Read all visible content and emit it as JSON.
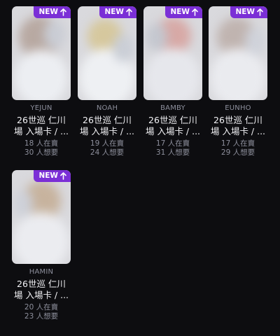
{
  "cards": [
    {
      "badge": "NEW",
      "badge_icon": "arrow-up-icon",
      "member": "YEJUN",
      "title_line1": "26世巡 仁川",
      "title_line2": "場 入場卡 / ...",
      "selling": "18 人在賣",
      "wanting": "30 人想要"
    },
    {
      "badge": "NEW",
      "badge_icon": "arrow-up-icon",
      "member": "NOAH",
      "title_line1": "26世巡 仁川",
      "title_line2": "場 入場卡 / ...",
      "selling": "19 人在賣",
      "wanting": "24 人想要"
    },
    {
      "badge": "NEW",
      "badge_icon": "arrow-up-icon",
      "member": "BAMBY",
      "title_line1": "26世巡 仁川",
      "title_line2": "場 入場卡 / ...",
      "selling": "17 人在賣",
      "wanting": "31 人想要"
    },
    {
      "badge": "NEW",
      "badge_icon": "arrow-up-icon",
      "member": "EUNHO",
      "title_line1": "26世巡 仁川",
      "title_line2": "場 入場卡 / ...",
      "selling": "17 人在賣",
      "wanting": "29 人想要"
    },
    {
      "badge": "NEW",
      "badge_icon": "arrow-up-icon",
      "member": "HAMIN",
      "title_line1": "26世巡 仁川",
      "title_line2": "場 入場卡 / ...",
      "selling": "20 人在賣",
      "wanting": "23 人想要"
    }
  ],
  "colors": {
    "background": "#0d0d10",
    "badge": "#7b2fd6",
    "muted_text": "#8d8f9c",
    "primary_text": "#f3f3f6"
  }
}
